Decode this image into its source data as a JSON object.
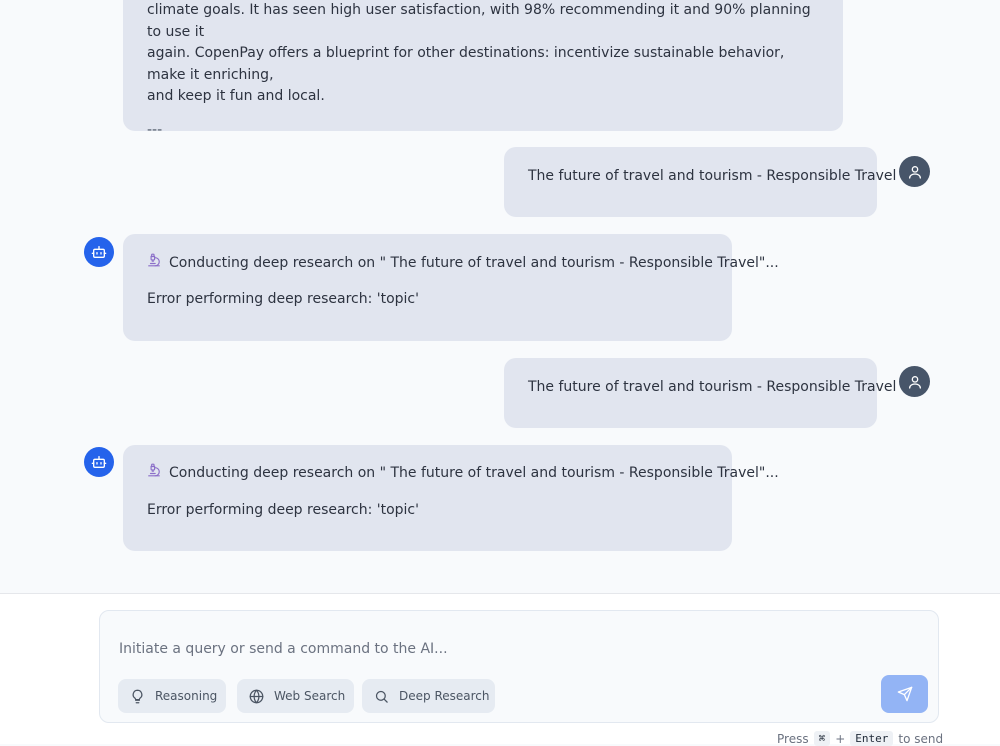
{
  "messages": [
    {
      "role": "assistant",
      "lines": [
        "climate goals. It has seen high user satisfaction, with 98% recommending it and 90% planning to use it",
        "again. CopenPay offers a blueprint for other destinations: incentivize sustainable behavior, make it enriching,",
        "and keep it fun and local."
      ],
      "separator": "---"
    },
    {
      "role": "user",
      "text": "The future of travel and tourism - Responsible Travel"
    },
    {
      "role": "assistant",
      "status": "Conducting deep research on \" The future of travel and tourism - Responsible Travel\"...",
      "error": "Error performing deep research: 'topic'"
    },
    {
      "role": "user",
      "text": "The future of travel and tourism - Responsible Travel"
    },
    {
      "role": "assistant",
      "status": "Conducting deep research on \" The future of travel and tourism - Responsible Travel\"...",
      "error": "Error performing deep research: 'topic'"
    }
  ],
  "composer": {
    "placeholder": "Initiate a query or send a command to the AI...",
    "tools": [
      {
        "label": "Reasoning",
        "icon": "lightbulb-icon"
      },
      {
        "label": "Web Search",
        "icon": "globe-icon"
      },
      {
        "label": "Deep Research",
        "icon": "search-icon"
      }
    ],
    "send_icon": "send-icon"
  },
  "hint": {
    "press": "Press",
    "key1": "⌘",
    "plus": "+",
    "key2": "Enter",
    "suffix": "to send"
  },
  "colors": {
    "accent": "#2563eb",
    "bubble": "#e1e5ef",
    "user_avatar": "#475569",
    "send_button": "#93b4f5"
  }
}
